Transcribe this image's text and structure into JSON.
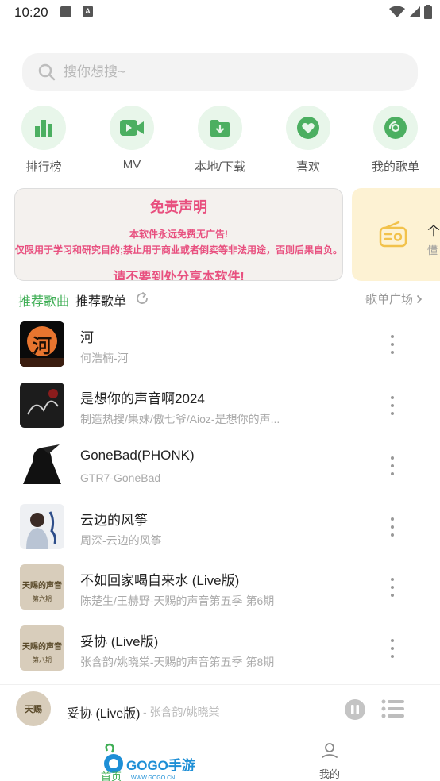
{
  "status_bar": {
    "time": "10:20",
    "notif_badge": "A"
  },
  "search": {
    "placeholder": "搜你想搜~"
  },
  "quick_nav": [
    {
      "label": "排行榜",
      "icon": "chart-icon"
    },
    {
      "label": "MV",
      "icon": "video-icon"
    },
    {
      "label": "本地/下载",
      "icon": "download-folder-icon"
    },
    {
      "label": "喜欢",
      "icon": "heart-icon"
    },
    {
      "label": "我的歌单",
      "icon": "disc-icon"
    }
  ],
  "banner": {
    "title": "免责声明",
    "line1": "本软件永远免费无广告!",
    "line2": "仅限用于学习和研究目的;禁止用于商业或者倒卖等非法用途，否则后果自负。",
    "line3": "请不要到处分享本软件!",
    "side_title": "个",
    "side_sub": "懂"
  },
  "tabs": {
    "active": "推荐歌曲",
    "second": "推荐歌单",
    "playlist_link": "歌单广场"
  },
  "songs": [
    {
      "title": "河",
      "subtitle": "何浩楠-河"
    },
    {
      "title": "是想你的声音啊2024",
      "subtitle": "制造热搜/果妹/傲七爷/Aioz-是想你的声..."
    },
    {
      "title": "GoneBad(PHONK)",
      "subtitle": "GTR7-GoneBad"
    },
    {
      "title": "云边的风筝",
      "subtitle": "周深-云边的风筝"
    },
    {
      "title": "不如回家喝自来水 (Live版)",
      "subtitle": "陈楚生/王赫野-天赐的声音第五季 第6期"
    },
    {
      "title": "妥协 (Live版)",
      "subtitle": "张含韵/姚晓棠-天赐的声音第五季 第8期"
    }
  ],
  "covers": {
    "c0": "河",
    "c4a": "天赐的声音",
    "c4b": "第六期",
    "c5a": "天赐的声音",
    "c5b": "第八期"
  },
  "mini_player": {
    "title": "妥协 (Live版)",
    "artist": " - 张含韵/姚晓棠",
    "cover_text": "天赐"
  },
  "bottom_nav": {
    "home": "首页",
    "mine": "我的",
    "watermark": "GOGO手游网",
    "watermark_url": "WWW.GOGO.CN"
  },
  "colors": {
    "accent": "#3fae55",
    "banner_text": "#e8507f",
    "icon_bg": "#e8f6ea"
  }
}
